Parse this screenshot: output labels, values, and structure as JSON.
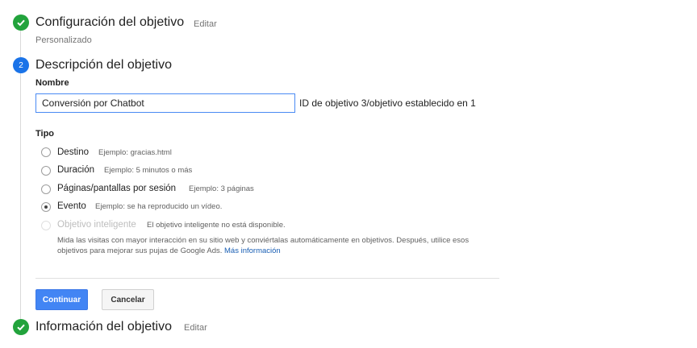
{
  "step1": {
    "title": "Configuración del objetivo",
    "edit": "Editar",
    "subtitle": "Personalizado"
  },
  "step2": {
    "number": "2",
    "title": "Descripción del objetivo"
  },
  "name_label": "Nombre",
  "name_value": "Conversión por Chatbot",
  "id_text": "ID de objetivo 3/objetivo establecido en 1",
  "type_label": "Tipo",
  "options": [
    {
      "label": "Destino",
      "example": "Ejemplo: gracias.html"
    },
    {
      "label": "Duración",
      "example": "Ejemplo: 5 minutos o más"
    },
    {
      "label": "Páginas/pantallas por sesión",
      "example": "Ejemplo: 3 páginas"
    },
    {
      "label": "Evento",
      "example": "Ejemplo: se ha reproducido un vídeo.",
      "selected": true
    },
    {
      "label": "Objetivo inteligente",
      "example": "El objetivo inteligente no está disponible.",
      "disabled": true
    }
  ],
  "smart_desc": "Mida las visitas con mayor interacción en su sitio web y conviértalas automáticamente en objetivos. Después, utilice esos objetivos para mejorar sus pujas de Google Ads.",
  "smart_link": "Más información",
  "buttons": {
    "continue": "Continuar",
    "cancel": "Cancelar"
  },
  "step3": {
    "title": "Información del objetivo",
    "edit": "Editar"
  },
  "colors": {
    "done": "#22a33c",
    "active": "#1a73e8",
    "primary_button": "#4285f4",
    "link": "#1a5fb4"
  }
}
